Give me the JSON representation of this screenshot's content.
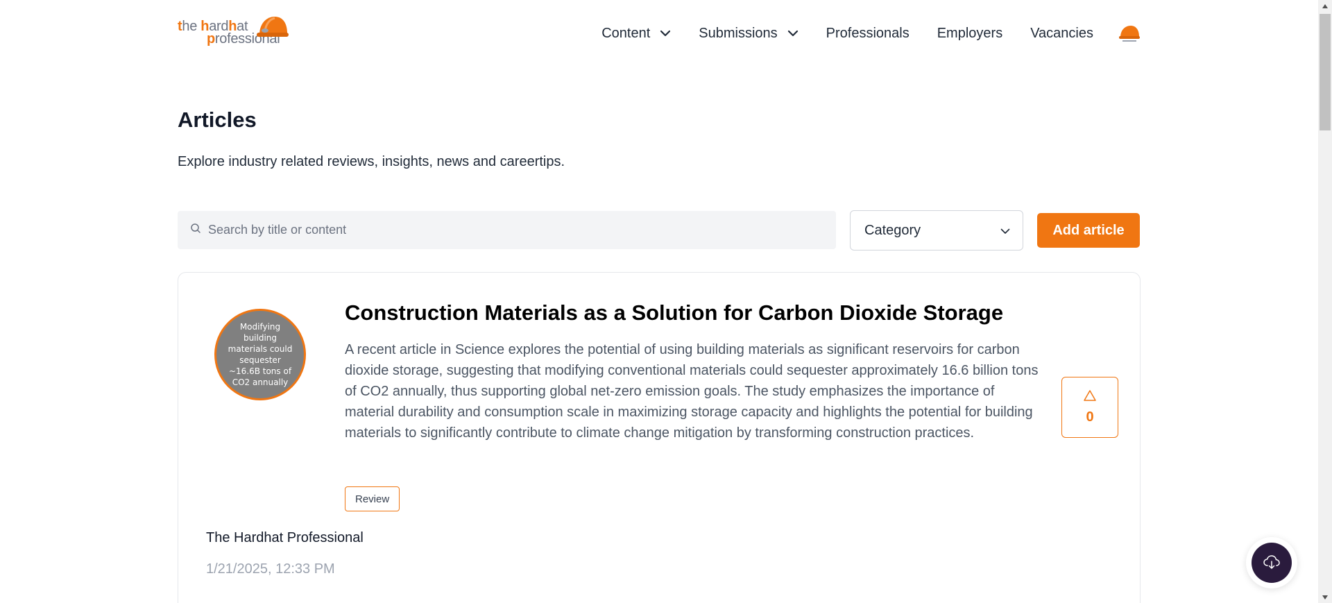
{
  "brand": {
    "logo_line1_a": "t",
    "logo_line1_b": "he ",
    "logo_line1_c": "h",
    "logo_line1_d": "ard",
    "logo_line1_e": "h",
    "logo_line1_f": "at",
    "logo_line2_a": "p",
    "logo_line2_b": "rofessional",
    "accent_color": "#f07612"
  },
  "nav": {
    "content": "Content",
    "submissions": "Submissions",
    "professionals": "Professionals",
    "employers": "Employers",
    "vacancies": "Vacancies"
  },
  "page": {
    "title": "Articles",
    "subtitle": "Explore industry related reviews, insights, news and careertips."
  },
  "filters": {
    "search_placeholder": "Search by title or content",
    "search_value": "",
    "category_label": "Category",
    "add_article": "Add article"
  },
  "articles": [
    {
      "thumbnail_text": "Modifying building materials could sequester ~16.6B tons of CO2 annually",
      "title": "Construction Materials as a Solution for Carbon Dioxide Storage",
      "description": "A recent article in Science explores the potential of using building materials as significant reservoirs for carbon dioxide storage, suggesting that modifying conventional materials could sequester approximately 16.6 billion tons of CO2 annually, thus supporting global net-zero emission goals. The study emphasizes the importance of material durability and consumption scale in maximizing storage capacity and highlights the potential for building materials to significantly contribute to climate change mitigation by transforming construction practices.",
      "tag": "Review",
      "votes": "0",
      "author": "The Hardhat Professional",
      "date": "1/21/2025, 12:33 PM"
    }
  ],
  "icons": {
    "search": "search-icon",
    "chevron": "chevron-down-icon",
    "upvote": "triangle-up-icon",
    "fab": "cloud-download-icon",
    "avatar": "hardhat-icon"
  }
}
